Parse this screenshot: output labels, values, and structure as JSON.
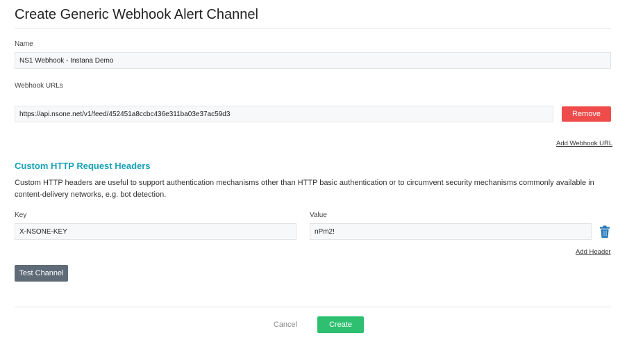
{
  "page": {
    "title": "Create Generic Webhook Alert Channel"
  },
  "name_field": {
    "label": "Name",
    "value": "NS1 Webhook - Instana Demo"
  },
  "webhook_urls": {
    "label": "Webhook URLs",
    "urls": [
      {
        "value": "https://api.nsone.net/v1/feed/452451a8ccbc436e311ba03e37ac59d3",
        "remove_label": "Remove"
      }
    ],
    "add_label": "Add Webhook URL"
  },
  "headers_section": {
    "title": "Custom HTTP Request Headers",
    "description": "Custom HTTP headers are useful to support authentication mechanisms other than HTTP basic authentication or to circumvent security mechanisms commonly available in content-delivery networks, e.g. bot detection.",
    "key_label": "Key",
    "value_label": "Value",
    "rows": [
      {
        "key": "X-NSONE-KEY",
        "value": "nPm2!"
      }
    ],
    "add_label": "Add Header",
    "delete_icon": "trash-icon"
  },
  "actions": {
    "test_label": "Test Channel",
    "cancel_label": "Cancel",
    "create_label": "Create"
  },
  "colors": {
    "accent_teal": "#17a2b8",
    "remove_red": "#ef4b4b",
    "create_green": "#2fbf71",
    "test_gray": "#5f6b77",
    "trash_blue": "#2477b8"
  }
}
